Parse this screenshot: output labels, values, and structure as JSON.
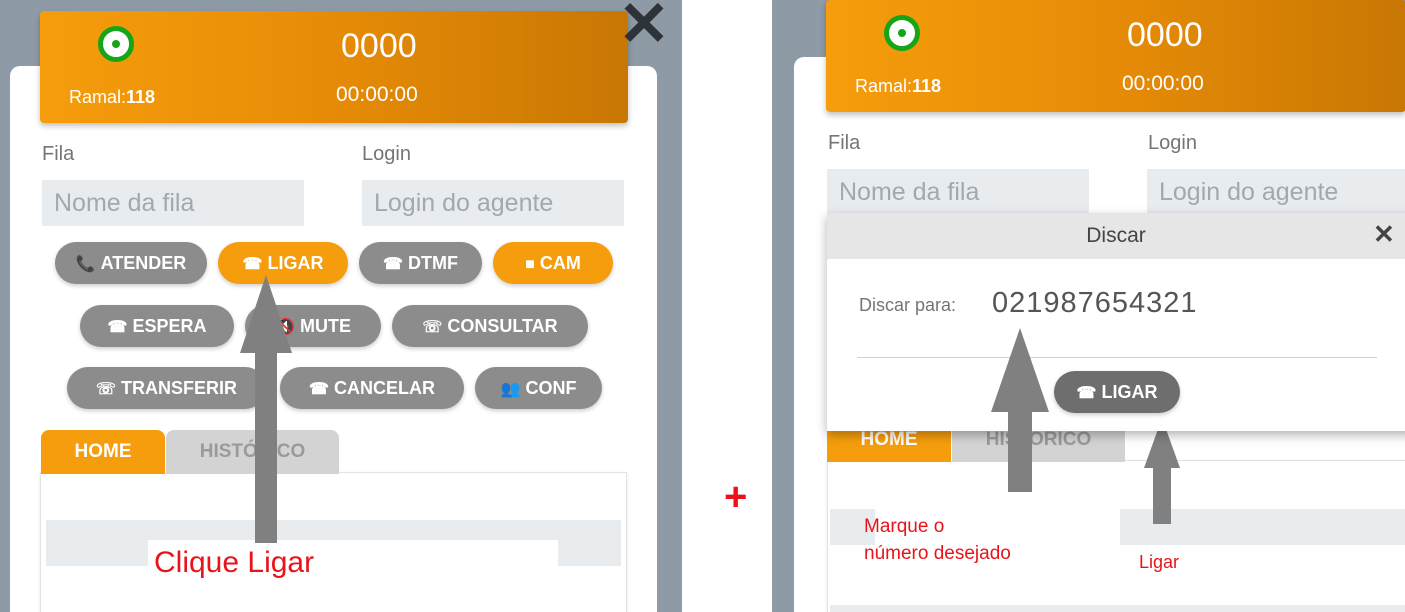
{
  "left": {
    "header": {
      "ramal_label": "Ramal:",
      "ramal_value": "118",
      "number": "0000",
      "timer": "00:00:00"
    },
    "close_icon": "✕",
    "fila_label": "Fila",
    "login_label": "Login",
    "fila_placeholder": "Nome da fila",
    "login_placeholder": "Login do agente",
    "buttons": {
      "atender": "ATENDER",
      "ligar": "LIGAR",
      "dtmf": "DTMF",
      "cam": "CAM",
      "espera": "ESPERA",
      "mute": "MUTE",
      "consultar": "CONSULTAR",
      "transferir": "TRANSFERIR",
      "cancelar": "CANCELAR",
      "conf": "CONF"
    },
    "tabs": {
      "home": "HOME",
      "historico": "HISTÓRICO"
    },
    "annotation": "Clique Ligar"
  },
  "plus_sign": "+",
  "right": {
    "header": {
      "ramal_label": "Ramal:",
      "ramal_value": "118",
      "number": "0000",
      "timer": "00:00:00"
    },
    "fila_label": "Fila",
    "login_label": "Login",
    "fila_placeholder": "Nome da fila",
    "login_placeholder": "Login do agente",
    "modal": {
      "title": "Discar",
      "close": "✕",
      "dial_label": "Discar para:",
      "dial_value": "021987654321",
      "ligar": "LIGAR"
    },
    "tabs": {
      "home": "HOME",
      "historico": "HISTÓRICO"
    },
    "annotation_dial": [
      "Marque o",
      "número desejado"
    ],
    "annotation_call": "Ligar"
  },
  "colors": {
    "accent": "#f59d0c",
    "status_green": "#16a516",
    "annotation": "#e8141a",
    "button_gray": "#8c8c8c"
  }
}
